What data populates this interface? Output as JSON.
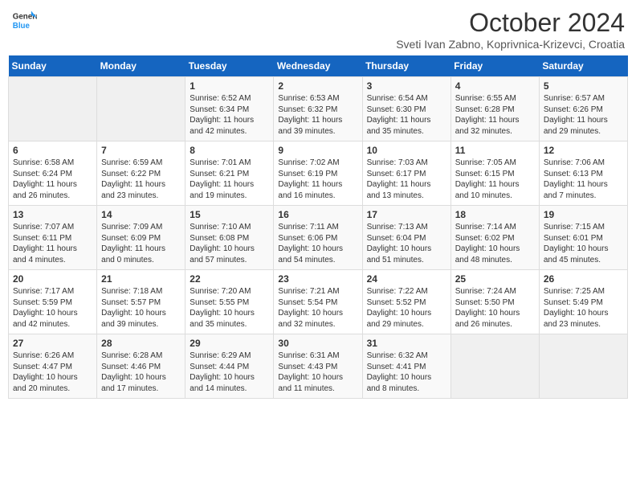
{
  "logo": {
    "line1": "General",
    "line2": "Blue"
  },
  "title": "October 2024",
  "subtitle": "Sveti Ivan Zabno, Koprivnica-Krizevci, Croatia",
  "days_of_week": [
    "Sunday",
    "Monday",
    "Tuesday",
    "Wednesday",
    "Thursday",
    "Friday",
    "Saturday"
  ],
  "weeks": [
    [
      {
        "day": "",
        "info": ""
      },
      {
        "day": "",
        "info": ""
      },
      {
        "day": "1",
        "info": "Sunrise: 6:52 AM\nSunset: 6:34 PM\nDaylight: 11 hours and 42 minutes."
      },
      {
        "day": "2",
        "info": "Sunrise: 6:53 AM\nSunset: 6:32 PM\nDaylight: 11 hours and 39 minutes."
      },
      {
        "day": "3",
        "info": "Sunrise: 6:54 AM\nSunset: 6:30 PM\nDaylight: 11 hours and 35 minutes."
      },
      {
        "day": "4",
        "info": "Sunrise: 6:55 AM\nSunset: 6:28 PM\nDaylight: 11 hours and 32 minutes."
      },
      {
        "day": "5",
        "info": "Sunrise: 6:57 AM\nSunset: 6:26 PM\nDaylight: 11 hours and 29 minutes."
      }
    ],
    [
      {
        "day": "6",
        "info": "Sunrise: 6:58 AM\nSunset: 6:24 PM\nDaylight: 11 hours and 26 minutes."
      },
      {
        "day": "7",
        "info": "Sunrise: 6:59 AM\nSunset: 6:22 PM\nDaylight: 11 hours and 23 minutes."
      },
      {
        "day": "8",
        "info": "Sunrise: 7:01 AM\nSunset: 6:21 PM\nDaylight: 11 hours and 19 minutes."
      },
      {
        "day": "9",
        "info": "Sunrise: 7:02 AM\nSunset: 6:19 PM\nDaylight: 11 hours and 16 minutes."
      },
      {
        "day": "10",
        "info": "Sunrise: 7:03 AM\nSunset: 6:17 PM\nDaylight: 11 hours and 13 minutes."
      },
      {
        "day": "11",
        "info": "Sunrise: 7:05 AM\nSunset: 6:15 PM\nDaylight: 11 hours and 10 minutes."
      },
      {
        "day": "12",
        "info": "Sunrise: 7:06 AM\nSunset: 6:13 PM\nDaylight: 11 hours and 7 minutes."
      }
    ],
    [
      {
        "day": "13",
        "info": "Sunrise: 7:07 AM\nSunset: 6:11 PM\nDaylight: 11 hours and 4 minutes."
      },
      {
        "day": "14",
        "info": "Sunrise: 7:09 AM\nSunset: 6:09 PM\nDaylight: 11 hours and 0 minutes."
      },
      {
        "day": "15",
        "info": "Sunrise: 7:10 AM\nSunset: 6:08 PM\nDaylight: 10 hours and 57 minutes."
      },
      {
        "day": "16",
        "info": "Sunrise: 7:11 AM\nSunset: 6:06 PM\nDaylight: 10 hours and 54 minutes."
      },
      {
        "day": "17",
        "info": "Sunrise: 7:13 AM\nSunset: 6:04 PM\nDaylight: 10 hours and 51 minutes."
      },
      {
        "day": "18",
        "info": "Sunrise: 7:14 AM\nSunset: 6:02 PM\nDaylight: 10 hours and 48 minutes."
      },
      {
        "day": "19",
        "info": "Sunrise: 7:15 AM\nSunset: 6:01 PM\nDaylight: 10 hours and 45 minutes."
      }
    ],
    [
      {
        "day": "20",
        "info": "Sunrise: 7:17 AM\nSunset: 5:59 PM\nDaylight: 10 hours and 42 minutes."
      },
      {
        "day": "21",
        "info": "Sunrise: 7:18 AM\nSunset: 5:57 PM\nDaylight: 10 hours and 39 minutes."
      },
      {
        "day": "22",
        "info": "Sunrise: 7:20 AM\nSunset: 5:55 PM\nDaylight: 10 hours and 35 minutes."
      },
      {
        "day": "23",
        "info": "Sunrise: 7:21 AM\nSunset: 5:54 PM\nDaylight: 10 hours and 32 minutes."
      },
      {
        "day": "24",
        "info": "Sunrise: 7:22 AM\nSunset: 5:52 PM\nDaylight: 10 hours and 29 minutes."
      },
      {
        "day": "25",
        "info": "Sunrise: 7:24 AM\nSunset: 5:50 PM\nDaylight: 10 hours and 26 minutes."
      },
      {
        "day": "26",
        "info": "Sunrise: 7:25 AM\nSunset: 5:49 PM\nDaylight: 10 hours and 23 minutes."
      }
    ],
    [
      {
        "day": "27",
        "info": "Sunrise: 6:26 AM\nSunset: 4:47 PM\nDaylight: 10 hours and 20 minutes."
      },
      {
        "day": "28",
        "info": "Sunrise: 6:28 AM\nSunset: 4:46 PM\nDaylight: 10 hours and 17 minutes."
      },
      {
        "day": "29",
        "info": "Sunrise: 6:29 AM\nSunset: 4:44 PM\nDaylight: 10 hours and 14 minutes."
      },
      {
        "day": "30",
        "info": "Sunrise: 6:31 AM\nSunset: 4:43 PM\nDaylight: 10 hours and 11 minutes."
      },
      {
        "day": "31",
        "info": "Sunrise: 6:32 AM\nSunset: 4:41 PM\nDaylight: 10 hours and 8 minutes."
      },
      {
        "day": "",
        "info": ""
      },
      {
        "day": "",
        "info": ""
      }
    ]
  ]
}
